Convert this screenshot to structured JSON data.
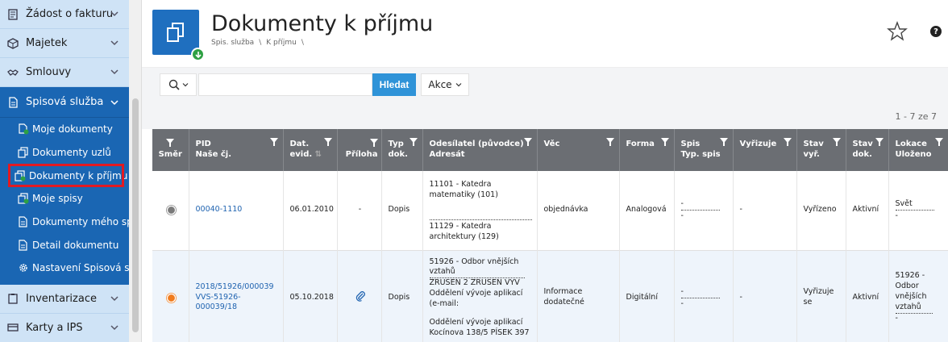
{
  "sidebar": {
    "items_top": [
      {
        "label": "Žádost o fakturu",
        "icon": "invoice-icon"
      },
      {
        "label": "Majetek",
        "icon": "box-icon"
      },
      {
        "label": "Smlouvy",
        "icon": "handshake-icon"
      }
    ],
    "section": {
      "label": "Spisová služba",
      "icon": "document-icon",
      "items": [
        {
          "label": "Moje dokumenty",
          "icon": "document-plus-icon"
        },
        {
          "label": "Dokumenty uzlů",
          "icon": "documents-stack-icon"
        },
        {
          "label": "Dokumenty k příjmu",
          "icon": "documents-incoming-icon",
          "active": true
        },
        {
          "label": "Moje spisy",
          "icon": "folder-plus-icon"
        },
        {
          "label": "Dokumenty mého spi...",
          "icon": "document-icon"
        },
        {
          "label": "Detail dokumentu",
          "icon": "document-detail-icon"
        },
        {
          "label": "Nastavení Spisová slu...",
          "icon": "gear-icon"
        }
      ]
    },
    "items_bottom": [
      {
        "label": "Inventarizace",
        "icon": "clipboard-icon"
      },
      {
        "label": "Karty a IPS",
        "icon": "card-icon"
      }
    ]
  },
  "header": {
    "title": "Dokumenty k příjmu",
    "breadcrumb": [
      "Spis. služba",
      "\\",
      "K příjmu",
      "\\"
    ],
    "help_label": "?"
  },
  "toolbar": {
    "search_placeholder": "",
    "search_button": "Hledat",
    "actions_label": "Akce"
  },
  "pager": {
    "label": "1 - 7 ze 7"
  },
  "table": {
    "headers": {
      "smer": "Směr",
      "pid": "PID",
      "pid2": "Naše čj.",
      "dat": "Dat.",
      "dat2": "evid.",
      "priloha": "Příloha",
      "typ": "Typ",
      "typ2": "dok.",
      "odes": "Odesílatel (původce)",
      "odes2": "Adresát",
      "vec": "Věc",
      "forma": "Forma",
      "spis": "Spis",
      "spis2": "Typ. spis",
      "vyrizuje": "Vyřizuje",
      "stavvyr": "Stav",
      "stavvyr2": "vyř.",
      "stavdok": "Stav",
      "stavdok2": "dok.",
      "lokace": "Lokace",
      "lokace2": "Uloženo"
    },
    "rows": [
      {
        "pid": "00040-1110",
        "pid2": "",
        "date": "06.01.2010",
        "priloha": "-",
        "typ": "Dopis",
        "sender": "11101 - Katedra matematiky (101)",
        "recipient": "11129 - Katedra architektury (129)",
        "vec": "objednávka",
        "forma": "Analogová",
        "spis": "-",
        "spis2": "-",
        "vyrizuje": "-",
        "stavvyr": "Vyřízeno",
        "stavdok": "Aktivní",
        "lokace": "Svět",
        "lokace2": "-"
      },
      {
        "pid": "2018/51926/000039",
        "pid2": "VVS-51926-000039/18",
        "date": "05.10.2018",
        "priloha": "",
        "typ": "Dopis",
        "sender1": "51926 - Odbor vnějších vztahů",
        "sender2": "ZRUSEN 2 ZRUSEN VYV Oddělení vývoje aplikací (e-mail:",
        "sender3": "Oddělení vývoje aplikací Kocínova 138/5 PÍSEK 397",
        "vec": "Informace dodatečné",
        "forma": "Digitální",
        "spis": "-",
        "spis2": "-",
        "vyrizuje": "-",
        "stavvyr": "Vyřizuje se",
        "stavdok": "Aktivní",
        "lokace": "51926 - Odbor vnějších vztahů",
        "lokace2": "-"
      }
    ]
  }
}
